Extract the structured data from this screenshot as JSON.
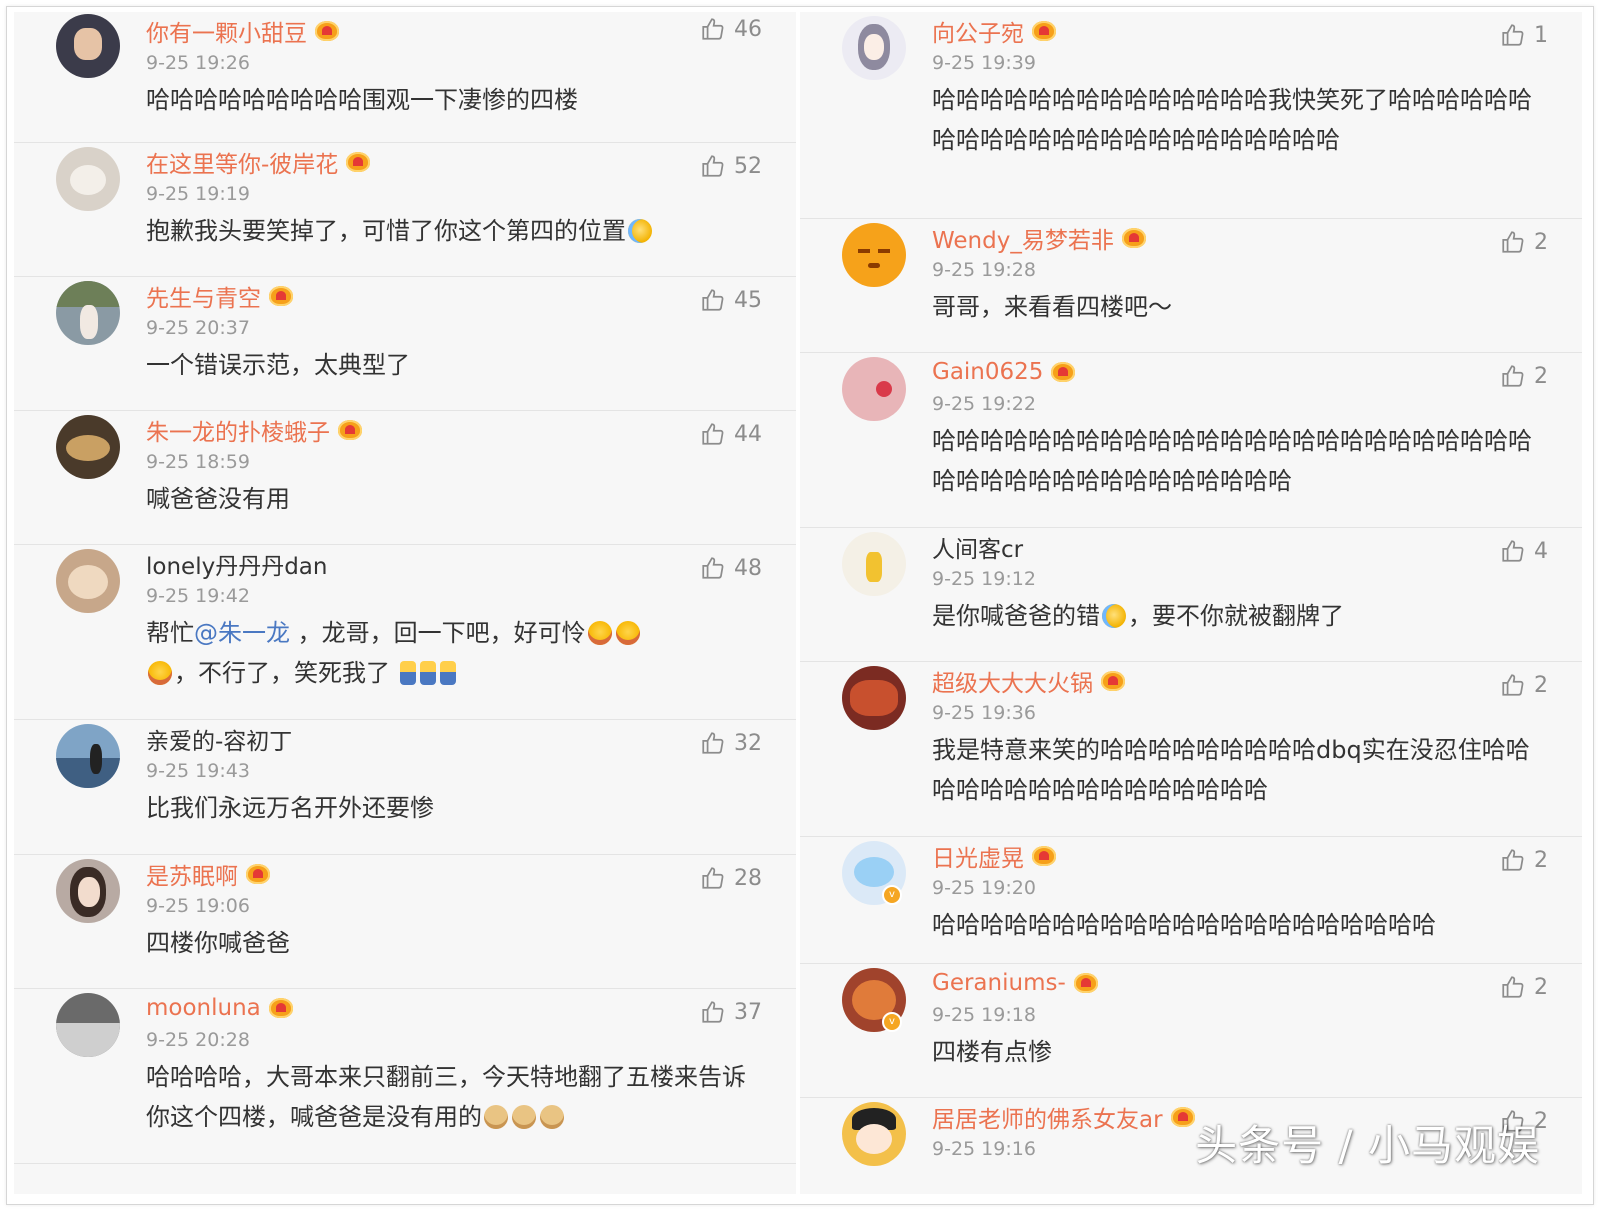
{
  "left_column": [
    {
      "username": "你有一颗小甜豆",
      "vip": true,
      "time": "9-25 19:26",
      "likes": "46",
      "text": "哈哈哈哈哈哈哈哈哈围观一下凄惨的四楼",
      "avatar_color": "#3b3b4a"
    },
    {
      "username": "在这里等你-彼岸花",
      "vip": true,
      "time": "9-25 19:19",
      "likes": "52",
      "text": "抱歉我头要笑掉了，可惜了你这个第四的位置",
      "avatar_color": "#d9d2c9"
    },
    {
      "username": "先生与青空",
      "vip": true,
      "time": "9-25 20:37",
      "likes": "45",
      "text": "一个错误示范，太典型了",
      "avatar_color": "#8a9aa4"
    },
    {
      "username": "朱一龙的扑棱蛾子",
      "vip": true,
      "time": "9-25 18:59",
      "likes": "44",
      "text": "喊爸爸没有用",
      "avatar_color": "#4a3a2a"
    },
    {
      "username": "lonely丹丹丹dan",
      "vip": false,
      "time": "9-25 19:42",
      "likes": "48",
      "text_a": "帮忙",
      "mention": "@朱一龙",
      "text_b": " ，龙哥，回一下吧，好可怜",
      "text_c": "，不行了，笑死我了",
      "avatar_color": "#c7a78a"
    },
    {
      "username": "亲爱的-容初丁",
      "vip": false,
      "time": "9-25 19:43",
      "likes": "32",
      "text": "比我们永远万名开外还要惨",
      "avatar_color": "#7fa4c6"
    },
    {
      "username": "是苏眠啊",
      "vip": true,
      "time": "9-25 19:06",
      "likes": "28",
      "text": "四楼你喊爸爸",
      "avatar_color": "#b8aaa3"
    },
    {
      "username": "moonluna",
      "vip": true,
      "time": "9-25 20:28",
      "likes": "37",
      "text": "哈哈哈哈，大哥本来只翻前三，今天特地翻了五楼来告诉你这个四楼，喊爸爸是没有用的",
      "avatar_color": "#6a6a6a"
    }
  ],
  "right_column": [
    {
      "username": "向公子宛",
      "vip": true,
      "time": "9-25 19:39",
      "likes": "1",
      "text": "哈哈哈哈哈哈哈哈哈哈哈哈哈哈我快笑死了哈哈哈哈哈哈哈哈哈哈哈哈哈哈哈哈哈哈哈哈哈哈哈",
      "avatar_color": "#ecebf3"
    },
    {
      "username": "Wendy_易梦若非",
      "vip": true,
      "time": "9-25 19:28",
      "likes": "2",
      "text": "哥哥，来看看四楼吧～",
      "avatar_color": "#f6a21a"
    },
    {
      "username": "Gain0625",
      "vip": true,
      "time": "9-25 19:22",
      "likes": "2",
      "text": "哈哈哈哈哈哈哈哈哈哈哈哈哈哈哈哈哈哈哈哈哈哈哈哈哈哈哈哈哈哈哈哈哈哈哈哈哈哈哈哈",
      "avatar_color": "#e8b5b8"
    },
    {
      "username": "人间客cr",
      "vip": false,
      "time": "9-25 19:12",
      "likes": "4",
      "text_a": "是你喊爸爸的错",
      "text_b": "，要不你就被翻牌了",
      "avatar_color": "#f4f0e6"
    },
    {
      "username": "超级大大大火锅",
      "vip": true,
      "time": "9-25 19:36",
      "likes": "2",
      "text": "我是特意来笑的哈哈哈哈哈哈哈哈哈dbq实在没忍住哈哈哈哈哈哈哈哈哈哈哈哈哈哈哈哈",
      "avatar_color": "#7b2b22"
    },
    {
      "username": "日光虚晃",
      "vip": true,
      "time": "9-25 19:20",
      "likes": "2",
      "text": "哈哈哈哈哈哈哈哈哈哈哈哈哈哈哈哈哈哈哈哈哈",
      "avatar_color": "#dbe9f7"
    },
    {
      "username": "Geraniums-",
      "vip": true,
      "time": "9-25 19:18",
      "likes": "2",
      "text": "四楼有点惨",
      "avatar_color": "#a0432c"
    },
    {
      "username": "居居老师的佛系女友ar",
      "vip": true,
      "time": "9-25 19:16",
      "likes": "2",
      "text": "",
      "avatar_color": "#f3c04a"
    }
  ],
  "watermark": "头条号 / 小马观娱",
  "icons": {
    "like": "thumbs-up-icon",
    "vip": "vip-crown-icon",
    "verified": "verified-v-icon"
  }
}
